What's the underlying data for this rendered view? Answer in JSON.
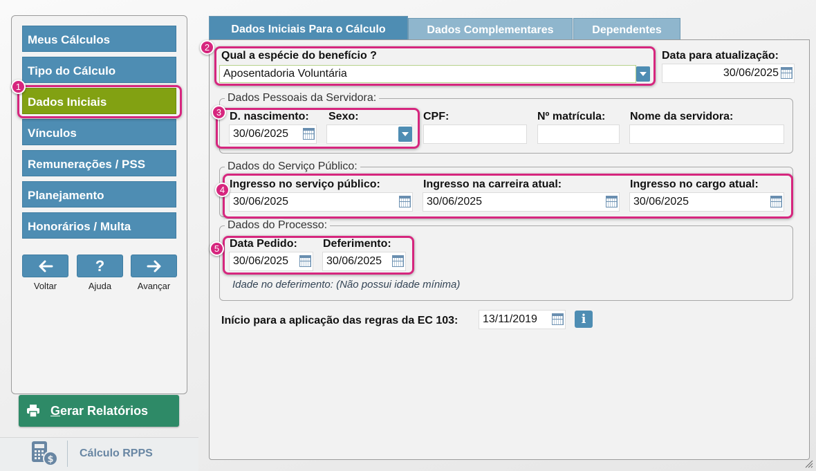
{
  "sidebar": {
    "items": [
      {
        "label": "Meus Cálculos"
      },
      {
        "label": "Tipo do Cálculo"
      },
      {
        "label": "Dados Iniciais"
      },
      {
        "label": "Vínculos"
      },
      {
        "label": "Remunerações / PSS"
      },
      {
        "label": "Planejamento"
      },
      {
        "label": "Honorários / Multa"
      }
    ],
    "back_label": "Voltar",
    "help_label": "Ajuda",
    "next_label": "Avançar",
    "report_prefix": "G",
    "report_rest": "erar Relatórios"
  },
  "brand": {
    "name": "Cálculo RPPS"
  },
  "tabs": [
    {
      "label": "Dados Iniciais Para o Cálculo"
    },
    {
      "label": "Dados Complementares"
    },
    {
      "label": "Dependentes"
    }
  ],
  "form": {
    "beneficio_label": "Qual a espécie do benefício ?",
    "beneficio_value": "Aposentadoria Voluntária",
    "atualizacao_label": "Data para atualização:",
    "atualizacao_value": "30/06/2025",
    "pessoais_legend": "Dados Pessoais da Servidora:",
    "nascimento_label": "D. nascimento:",
    "nascimento_value": "30/06/2025",
    "sexo_label": "Sexo:",
    "sexo_value": "",
    "cpf_label": "CPF:",
    "cpf_value": "",
    "matricula_label": "Nº matrícula:",
    "matricula_value": "",
    "nome_label": "Nome da servidora:",
    "nome_value": "",
    "servico_legend": "Dados do Serviço Público:",
    "ingresso_servico_label": "Ingresso no serviço público:",
    "ingresso_servico_value": "30/06/2025",
    "ingresso_carreira_label": "Ingresso na carreira atual:",
    "ingresso_carreira_value": "30/06/2025",
    "ingresso_cargo_label": "Ingresso no cargo atual:",
    "ingresso_cargo_value": "30/06/2025",
    "processo_legend": "Dados do Processo:",
    "pedido_label": "Data Pedido:",
    "pedido_value": "30/06/2025",
    "deferimento_label": "Deferimento:",
    "deferimento_value": "30/06/2025",
    "idade_note": "Idade no deferimento:  (Não possui idade mínima)",
    "ec103_label": "Início para a aplicação das regras da EC 103:",
    "ec103_value": "13/11/2019"
  },
  "annotations": [
    "1",
    "2",
    "3",
    "4",
    "5"
  ],
  "colors": {
    "accent": "#4e8db3",
    "active": "#82a112",
    "highlight": "#d6267e",
    "report": "#2e8a67"
  }
}
